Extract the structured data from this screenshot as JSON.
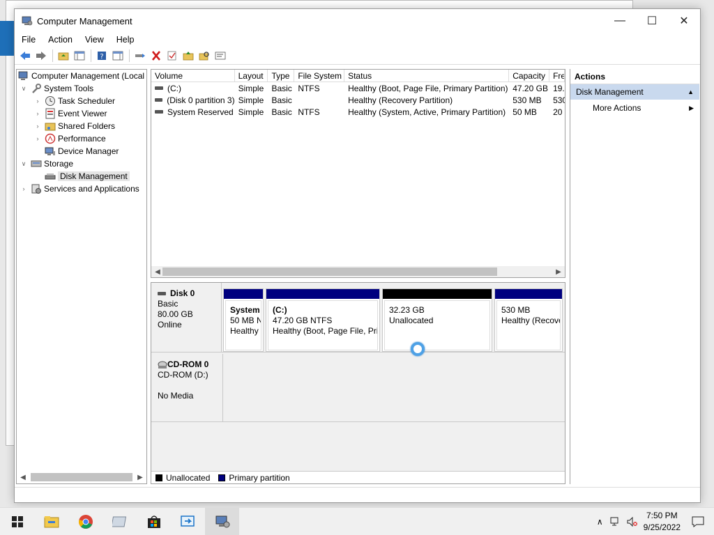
{
  "window": {
    "title": "Computer Management"
  },
  "menu": [
    "File",
    "Action",
    "View",
    "Help"
  ],
  "tree": {
    "root": "Computer Management (Local",
    "system_tools": "System Tools",
    "task_scheduler": "Task Scheduler",
    "event_viewer": "Event Viewer",
    "shared_folders": "Shared Folders",
    "performance": "Performance",
    "device_manager": "Device Manager",
    "storage": "Storage",
    "disk_management": "Disk Management",
    "services": "Services and Applications"
  },
  "volumes": {
    "headers": [
      "Volume",
      "Layout",
      "Type",
      "File System",
      "Status",
      "Capacity",
      "Fre"
    ],
    "rows": [
      [
        "(C:)",
        "Simple",
        "Basic",
        "NTFS",
        "Healthy (Boot, Page File, Primary Partition)",
        "47.20 GB",
        "19."
      ],
      [
        "(Disk 0 partition 3)",
        "Simple",
        "Basic",
        "",
        "Healthy (Recovery Partition)",
        "530 MB",
        "530"
      ],
      [
        "System Reserved",
        "Simple",
        "Basic",
        "NTFS",
        "Healthy (System, Active, Primary Partition)",
        "50 MB",
        "20"
      ]
    ]
  },
  "disk0": {
    "name": "Disk 0",
    "type": "Basic",
    "size": "80.00 GB",
    "state": "Online",
    "partitions": [
      {
        "name": "System",
        "line1": "50 MB N",
        "line2": "Healthy",
        "kind": "primary"
      },
      {
        "name": "(C:)",
        "line1": "47.20 GB NTFS",
        "line2": "Healthy (Boot, Page File, Prir",
        "kind": "primary"
      },
      {
        "name": "",
        "line1": "32.23 GB",
        "line2": "Unallocated",
        "kind": "unallocated"
      },
      {
        "name": "",
        "line1": "530 MB",
        "line2": "Healthy (Recove",
        "kind": "primary"
      }
    ]
  },
  "cdrom": {
    "name": "CD-ROM 0",
    "line1": "CD-ROM (D:)",
    "line2": "No Media"
  },
  "legend": {
    "unallocated": "Unallocated",
    "primary": "Primary partition"
  },
  "actions": {
    "header": "Actions",
    "section": "Disk Management",
    "more": "More Actions"
  },
  "clock": {
    "time": "7:50 PM",
    "date": "9/25/2022"
  },
  "colors": {
    "primary": "#00007f",
    "unallocated": "#000000",
    "selection": "#c9d9ee"
  }
}
